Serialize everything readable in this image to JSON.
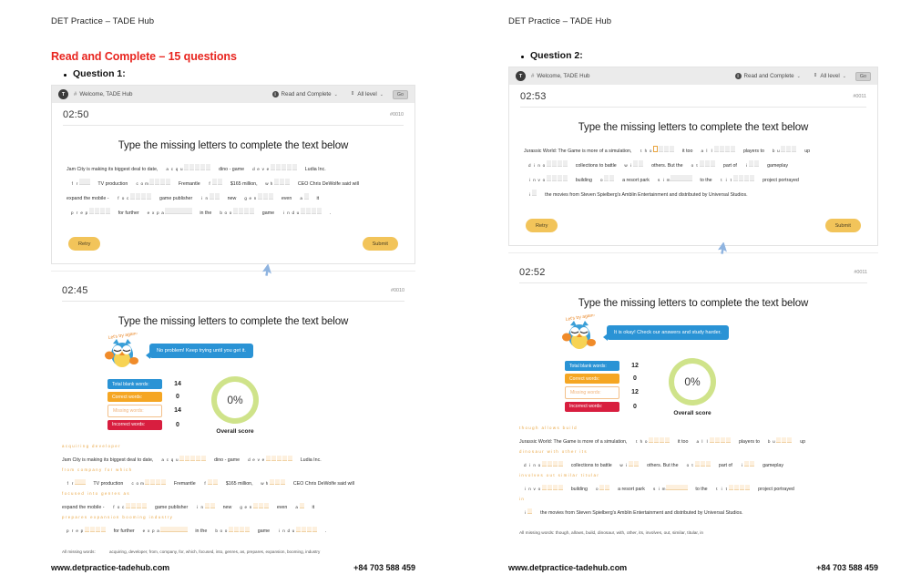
{
  "document": {
    "header": "DET Practice – TADE Hub",
    "section_title": "Read and Complete – 15 questions",
    "footer_url": "www.detpractice-tadehub.com",
    "footer_phone": "+84 703 588 459"
  },
  "colors": {
    "accent_red": "#e8251f",
    "blue": "#2a93d5",
    "orange": "#f5a623",
    "red": "#d81e3f",
    "yellow_button": "#f2c45a",
    "correction": "#e8a33d",
    "donut_ring": "#cfe38a"
  },
  "appbar": {
    "avatar_initial": "T",
    "hash": "#",
    "welcome": "Welcome, TADE Hub",
    "mode": "Read and Complete",
    "level": "All level",
    "go_label": "Go",
    "chevron": "⌄",
    "updown": "⇕",
    "info_glyph": "i"
  },
  "left": {
    "question_label": "Question 1:",
    "attempt": {
      "timer": "02:50",
      "qid": "#0010",
      "prompt": "Type the missing letters to complete the text below",
      "retry_label": "Retry",
      "submit_label": "Submit"
    },
    "result": {
      "timer": "02:45",
      "qid": "#0010",
      "prompt": "Type the missing letters to complete the text below",
      "owl_caption": "Let's try again!",
      "bubble": "No problem! Keep trying until you get it.",
      "stats": [
        {
          "label": "Total blank words:",
          "value": "14",
          "style": "blue"
        },
        {
          "label": "Correct words:",
          "value": "0",
          "style": "orange"
        },
        {
          "label": "Missing words:",
          "value": "14",
          "style": "missing"
        },
        {
          "label": "Incorrect words:",
          "value": "0",
          "style": "red"
        }
      ],
      "score": "0%",
      "score_label": "Overall score",
      "all_missing_label": "All missing words:",
      "all_missing_value": "acquiring, developer, from, company, for, which, focused, into, genres, as, prepares, expansion, booming, industry"
    },
    "passage_lines": [
      [
        {
          "t": "text",
          "v": "Jam City is making its biggest deal to date,"
        },
        {
          "t": "blank",
          "shown": "a c q u",
          "boxes": 5,
          "answer": "acquiring"
        },
        {
          "t": "text",
          "v": "dino - game"
        },
        {
          "t": "blank",
          "shown": "d e v e",
          "boxes": 5,
          "answer": "developer"
        },
        {
          "t": "text",
          "v": "Ludia Inc."
        }
      ],
      [
        {
          "t": "blank",
          "shown": "f r",
          "boxes": 2,
          "answer": "from"
        },
        {
          "t": "text",
          "v": "TV production"
        },
        {
          "t": "blank",
          "shown": "c o m",
          "boxes": 4,
          "answer": "company"
        },
        {
          "t": "text",
          "v": "Fremantle"
        },
        {
          "t": "blank",
          "shown": "f",
          "boxes": 2,
          "answer": "for"
        },
        {
          "t": "text",
          "v": "$165 million,"
        },
        {
          "t": "blank",
          "shown": "w h",
          "boxes": 3,
          "answer": "which"
        },
        {
          "t": "text",
          "v": "CEO Chris DeWolfe said will"
        }
      ],
      [
        {
          "t": "text",
          "v": "expand the mobile -"
        },
        {
          "t": "blank",
          "shown": "f o c",
          "boxes": 4,
          "answer": "focused"
        },
        {
          "t": "text",
          "v": "game publisher"
        },
        {
          "t": "blank",
          "shown": "i n",
          "boxes": 2,
          "answer": "into"
        },
        {
          "t": "text",
          "v": "new"
        },
        {
          "t": "blank",
          "shown": "g e n",
          "boxes": 3,
          "answer": "genres"
        },
        {
          "t": "text",
          "v": "even"
        },
        {
          "t": "blank",
          "shown": "a",
          "boxes": 1,
          "answer": "as"
        },
        {
          "t": "text",
          "v": "it"
        }
      ],
      [
        {
          "t": "blank",
          "shown": "p r e p",
          "boxes": 4,
          "answer": "prepares"
        },
        {
          "t": "text",
          "v": "for further"
        },
        {
          "t": "blank",
          "shown": "e x p a",
          "boxes": 5,
          "answer": "expansion"
        },
        {
          "t": "text",
          "v": "in the"
        },
        {
          "t": "blank",
          "shown": "b o o",
          "boxes": 4,
          "answer": "booming"
        },
        {
          "t": "text",
          "v": "game"
        },
        {
          "t": "blank",
          "shown": "i n d u",
          "boxes": 4,
          "answer": "industry"
        },
        {
          "t": "text",
          "v": "."
        }
      ]
    ]
  },
  "right": {
    "question_label": "Question 2:",
    "attempt": {
      "timer": "02:53",
      "qid": "#0011",
      "prompt": "Type the missing letters to complete the text below",
      "retry_label": "Retry",
      "submit_label": "Submit"
    },
    "result": {
      "timer": "02:52",
      "qid": "#0011",
      "prompt": "Type the missing letters to complete the text below",
      "owl_caption": "Let's try again!",
      "bubble": "It is okay! Check our answers and study harder.",
      "stats": [
        {
          "label": "Total blank words:",
          "value": "12",
          "style": "blue"
        },
        {
          "label": "Correct words:",
          "value": "0",
          "style": "orange"
        },
        {
          "label": "Missing words:",
          "value": "12",
          "style": "missing"
        },
        {
          "label": "Incorrect words:",
          "value": "0",
          "style": "red"
        }
      ],
      "score": "0%",
      "score_label": "Overall score",
      "all_missing_value": "All missing words: though, allows, build, dinosaur, with, other, its, involves, out, similar, titular, in"
    },
    "passage_lines": [
      [
        {
          "t": "text",
          "v": "Jurassic World: The Game is more of a simulation,"
        },
        {
          "t": "blank",
          "shown": "t h o",
          "boxes": 4,
          "answer": "though",
          "active": true
        },
        {
          "t": "text",
          "v": "it too"
        },
        {
          "t": "blank",
          "shown": "a l l",
          "boxes": 4,
          "answer": "allows"
        },
        {
          "t": "text",
          "v": "players to"
        },
        {
          "t": "blank",
          "shown": "b u",
          "boxes": 3,
          "answer": "build"
        },
        {
          "t": "text",
          "v": "up"
        }
      ],
      [
        {
          "t": "blank",
          "shown": "d i n o",
          "boxes": 4,
          "answer": "dinosaur"
        },
        {
          "t": "text",
          "v": "collections to battle"
        },
        {
          "t": "blank",
          "shown": "w i",
          "boxes": 2,
          "answer": "with"
        },
        {
          "t": "text",
          "v": "others. But the"
        },
        {
          "t": "blank",
          "shown": "o t",
          "boxes": 3,
          "answer": "other"
        },
        {
          "t": "text",
          "v": "part of"
        },
        {
          "t": "blank",
          "shown": "i",
          "boxes": 2,
          "answer": "its"
        },
        {
          "t": "text",
          "v": "gameplay"
        }
      ],
      [
        {
          "t": "blank",
          "shown": "i n v o",
          "boxes": 4,
          "answer": "involves"
        },
        {
          "t": "text",
          "v": "building"
        },
        {
          "t": "blank",
          "shown": "o",
          "boxes": 2,
          "answer": "out"
        },
        {
          "t": "text",
          "v": "a resort park"
        },
        {
          "t": "blank",
          "shown": "s i m",
          "boxes": 4,
          "answer": "similar"
        },
        {
          "t": "text",
          "v": "to the"
        },
        {
          "t": "blank",
          "shown": "t i t",
          "boxes": 4,
          "answer": "titular"
        },
        {
          "t": "text",
          "v": "project portrayed"
        }
      ],
      [
        {
          "t": "blank",
          "shown": "i",
          "boxes": 1,
          "answer": "in"
        },
        {
          "t": "text",
          "v": "the movies from Steven Spielberg's Amblin Entertainment and distributed by Universal Studios."
        }
      ]
    ]
  }
}
